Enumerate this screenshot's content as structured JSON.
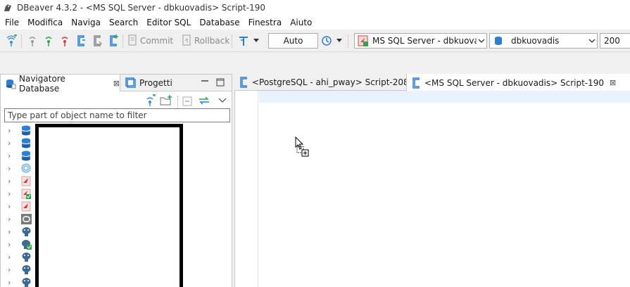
{
  "window": {
    "title": "DBeaver 4.3.2 - <MS SQL Server - dbkuovadis> Script-190",
    "app_icon": "dbeaver-beaver-icon"
  },
  "menu": [
    "File",
    "Modifica",
    "Naviga",
    "Search",
    "Editor SQL",
    "Database",
    "Finestra",
    "Aiuto"
  ],
  "toolbar": {
    "commit_label": "Commit",
    "rollback_label": "Rollback",
    "transaction_mode": "Auto",
    "connection": "MS SQL Server - dbkuovadi",
    "database": "dbkuovadis",
    "result_limit": "200"
  },
  "left_panel": {
    "tabs": [
      {
        "label": "Navigatore Database",
        "icon": "database-navigator-icon",
        "active": true
      },
      {
        "label": "Progetti",
        "icon": "projects-icon",
        "active": false
      }
    ],
    "filter_placeholder": "Type part of object name to filter",
    "tree_items": [
      {
        "icon": "database-icon"
      },
      {
        "icon": "database-icon"
      },
      {
        "icon": "database-icon"
      },
      {
        "icon": "search-database-icon"
      },
      {
        "icon": "sql-server-icon"
      },
      {
        "icon": "sql-server-connected-icon"
      },
      {
        "icon": "sql-server-icon"
      },
      {
        "icon": "generic-database-icon"
      },
      {
        "icon": "postgresql-icon"
      },
      {
        "icon": "postgresql-connected-icon"
      },
      {
        "icon": "postgresql-icon"
      },
      {
        "icon": "postgresql-icon"
      },
      {
        "icon": "postgresql-icon"
      }
    ]
  },
  "editor": {
    "tabs": [
      {
        "label": "<PostgreSQL - ahi_pway> Script-208",
        "active": false
      },
      {
        "label": "<MS SQL Server - dbkuovadis> Script-190",
        "active": true
      }
    ]
  },
  "colors": {
    "current_line": "#e8f2fe",
    "toolbar_bg": "#f0f0f0",
    "disabled_text": "#8a8a8a"
  }
}
